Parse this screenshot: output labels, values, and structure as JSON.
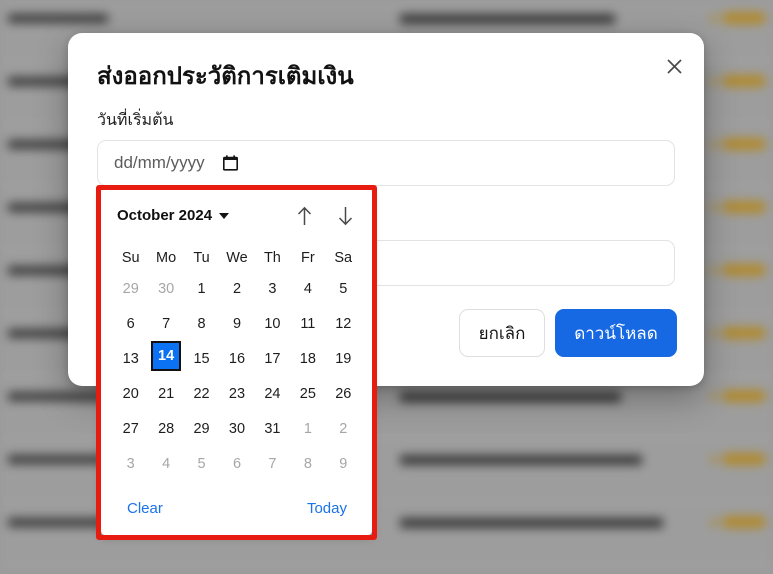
{
  "background": {
    "description": "blurred transaction history table",
    "row_count": 9,
    "badge_color": "#b08a2e"
  },
  "dialog": {
    "title": "ส่งออกประวัติการเติมเงิน",
    "close_icon": "close-icon",
    "fields": [
      {
        "label": "วันที่เริ่มต้น",
        "placeholder": "dd/mm/yyyy",
        "value": "",
        "icon": "calendar-picker-icon"
      },
      {
        "label": "",
        "placeholder": "",
        "value": "",
        "icon": ""
      }
    ],
    "buttons": {
      "cancel": "ยกเลิก",
      "download": "ดาวน์โหลด",
      "download_color": "#1668e3"
    }
  },
  "datepicker": {
    "month_label": "October 2024",
    "dropdown_icon": "chevron-down-icon",
    "prev_icon": "arrow-up-icon",
    "next_icon": "arrow-down-icon",
    "weekdays": [
      "Su",
      "Mo",
      "Tu",
      "We",
      "Th",
      "Fr",
      "Sa"
    ],
    "weeks": [
      [
        {
          "d": "29",
          "muted": true
        },
        {
          "d": "30",
          "muted": true
        },
        {
          "d": "1"
        },
        {
          "d": "2"
        },
        {
          "d": "3"
        },
        {
          "d": "4"
        },
        {
          "d": "5"
        }
      ],
      [
        {
          "d": "6"
        },
        {
          "d": "7"
        },
        {
          "d": "8"
        },
        {
          "d": "9"
        },
        {
          "d": "10"
        },
        {
          "d": "11"
        },
        {
          "d": "12"
        }
      ],
      [
        {
          "d": "13"
        },
        {
          "d": "14",
          "selected": true
        },
        {
          "d": "15"
        },
        {
          "d": "16"
        },
        {
          "d": "17"
        },
        {
          "d": "18"
        },
        {
          "d": "19"
        }
      ],
      [
        {
          "d": "20"
        },
        {
          "d": "21"
        },
        {
          "d": "22"
        },
        {
          "d": "23"
        },
        {
          "d": "24"
        },
        {
          "d": "25"
        },
        {
          "d": "26"
        }
      ],
      [
        {
          "d": "27"
        },
        {
          "d": "28"
        },
        {
          "d": "29"
        },
        {
          "d": "30"
        },
        {
          "d": "31"
        },
        {
          "d": "1",
          "muted": true
        },
        {
          "d": "2",
          "muted": true
        }
      ],
      [
        {
          "d": "3",
          "muted": true
        },
        {
          "d": "4",
          "muted": true
        },
        {
          "d": "5",
          "muted": true
        },
        {
          "d": "6",
          "muted": true
        },
        {
          "d": "7",
          "muted": true
        },
        {
          "d": "8",
          "muted": true
        },
        {
          "d": "9",
          "muted": true
        }
      ]
    ],
    "clear_label": "Clear",
    "today_label": "Today",
    "link_color": "#1a73e8",
    "selected_color": "#0b72f4"
  },
  "annotation": {
    "highlight_color": "#e81b10"
  }
}
